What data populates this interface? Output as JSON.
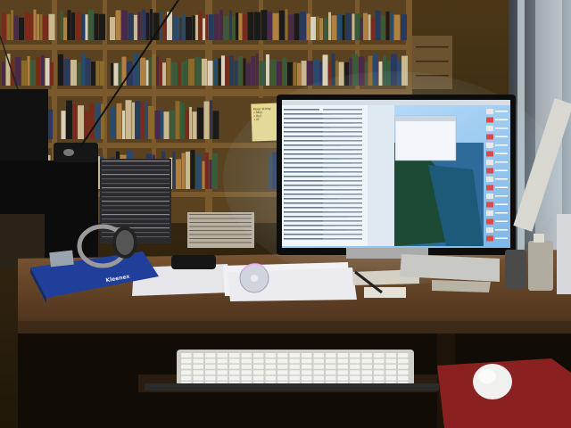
{
  "scene": {
    "description_visible_text": {
      "sticky_note_lines": [
        "Keep sticky",
        "• Mon",
        "• Ret",
        "• Pl"
      ],
      "box_label": "Kleenex"
    },
    "colors": {
      "wall": "#3a2a14",
      "bookshelf": "#5a4220",
      "desk": "#6b4a2a",
      "screen_glow": "#9fd4ff",
      "keyboard": "#d8d8d0",
      "mousepad": "#8a2020"
    },
    "icons": {
      "monitor": "monitor-icon",
      "keyboard": "keyboard-icon",
      "mouse": "mouse-icon",
      "headphones": "headphones-icon",
      "cd": "cd-icon"
    }
  }
}
